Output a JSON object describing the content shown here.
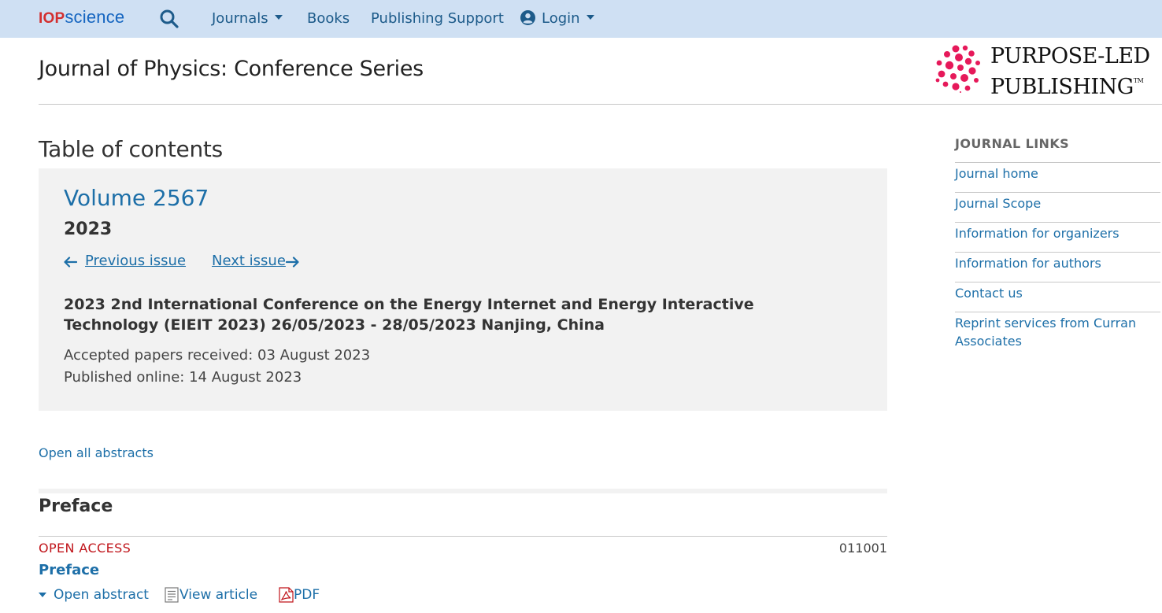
{
  "topbar": {
    "logo_iop": "IOP",
    "logo_science": "science",
    "nav": {
      "journals": "Journals",
      "books": "Books",
      "publishing_support": "Publishing Support",
      "login": "Login"
    }
  },
  "header": {
    "journal_title": "Journal of Physics: Conference Series",
    "brand_line1": "PURPOSE-LED",
    "brand_line2": "PUBLISHING",
    "brand_tm": "TM"
  },
  "main": {
    "toc_heading": "Table of contents",
    "issue": {
      "volume": "Volume 2567",
      "year": "2023",
      "previous_issue": "Previous issue",
      "next_issue": "Next issue",
      "conference_title": "2023 2nd International Conference on the Energy Internet and Energy Interactive Technology (EIEIT 2023) 26/05/2023 - 28/05/2023 Nanjing, China",
      "accepted": "Accepted papers received: 03 August 2023",
      "published": "Published online: 14 August 2023"
    },
    "open_all_abstracts": "Open all abstracts",
    "section_title": "Preface",
    "article": {
      "access": "OPEN ACCESS",
      "number": "011001",
      "title": "Preface",
      "open_abstract": "Open abstract",
      "view_article": "View article",
      "pdf": "PDF"
    }
  },
  "sidebar": {
    "heading": "JOURNAL LINKS",
    "links": [
      "Journal home",
      "Journal Scope",
      "Information for organizers",
      "Information for authors",
      "Contact us",
      "Reprint services from Curran Associates"
    ]
  },
  "colors": {
    "topbar_bg": "#cfe0f3",
    "link_blue": "#1d6fa8",
    "open_access_red": "#c0151b",
    "brand_pink": "#e6195a",
    "panel_gray": "#f2f2f2"
  },
  "icons": [
    "search-icon",
    "user-icon",
    "caret-down-icon",
    "arrow-left-icon",
    "arrow-right-icon",
    "document-icon",
    "pdf-icon",
    "brand-dots-logo"
  ]
}
